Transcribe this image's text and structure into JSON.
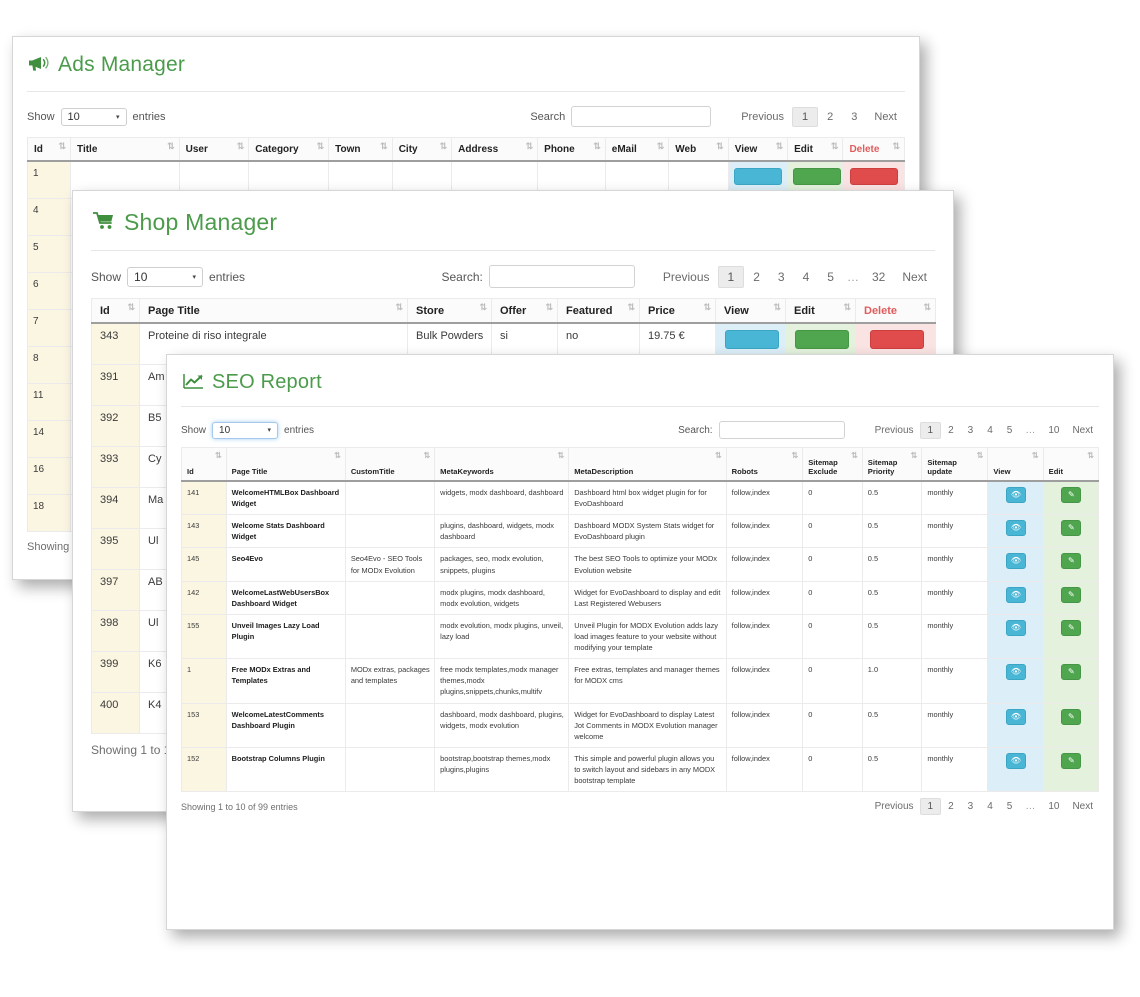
{
  "windows": {
    "ads": {
      "title": "Ads Manager",
      "icon": "megaphone-icon",
      "length": {
        "label_before": "Show",
        "value": "10",
        "label_after": "entries"
      },
      "search": {
        "label": "Search",
        "value": "",
        "placeholder": ""
      },
      "pagination": {
        "previous": "Previous",
        "pages": [
          "1",
          "2",
          "3"
        ],
        "active": "1",
        "next": "Next"
      },
      "columns": [
        "Id",
        "Title",
        "User",
        "Category",
        "Town",
        "City",
        "Address",
        "Phone",
        "eMail",
        "Web",
        "View",
        "Edit",
        "Delete"
      ],
      "rows": [
        {
          "id": "1"
        },
        {
          "id": "4"
        },
        {
          "id": "5"
        },
        {
          "id": "6"
        },
        {
          "id": "7"
        },
        {
          "id": "8"
        },
        {
          "id": "11"
        },
        {
          "id": "14"
        },
        {
          "id": "16"
        },
        {
          "id": "18"
        }
      ],
      "footer_info": "Showing 1 to 10 of 24 entries"
    },
    "shop": {
      "title": "Shop Manager",
      "icon": "shopping-cart-icon",
      "length": {
        "label_before": "Show",
        "value": "10",
        "label_after": "entries"
      },
      "search": {
        "label": "Search:",
        "value": "",
        "placeholder": ""
      },
      "pagination": {
        "previous": "Previous",
        "pages": [
          "1",
          "2",
          "3",
          "4",
          "5",
          "…",
          "32"
        ],
        "active": "1",
        "next": "Next"
      },
      "columns": [
        "Id",
        "Page Title",
        "Store",
        "Offer",
        "Featured",
        "Price",
        "View",
        "Edit",
        "Delete"
      ],
      "rows": [
        {
          "id": "343",
          "page_title": "Proteine di riso integrale",
          "store": "Bulk Powders",
          "offer": "si",
          "featured": "no",
          "price": "19.75 €"
        },
        {
          "id": "391",
          "page_title": "Am",
          "store": "",
          "offer": "",
          "featured": "",
          "price": ""
        },
        {
          "id": "392",
          "page_title": "B5",
          "store": "",
          "offer": "",
          "featured": "",
          "price": ""
        },
        {
          "id": "393",
          "page_title": "Cy",
          "store": "",
          "offer": "",
          "featured": "",
          "price": ""
        },
        {
          "id": "394",
          "page_title": "Ma",
          "store": "",
          "offer": "",
          "featured": "",
          "price": ""
        },
        {
          "id": "395",
          "page_title": "Ul",
          "store": "",
          "offer": "",
          "featured": "",
          "price": ""
        },
        {
          "id": "397",
          "page_title": "AB",
          "store": "",
          "offer": "",
          "featured": "",
          "price": ""
        },
        {
          "id": "398",
          "page_title": "Ul",
          "store": "",
          "offer": "",
          "featured": "",
          "price": ""
        },
        {
          "id": "399",
          "page_title": "K6",
          "store": "",
          "offer": "",
          "featured": "",
          "price": ""
        },
        {
          "id": "400",
          "page_title": "K4",
          "store": "",
          "offer": "",
          "featured": "",
          "price": ""
        }
      ],
      "footer_info": "Showing 1 to 10 of 316 entries"
    },
    "seo": {
      "title": "SEO Report",
      "icon": "chart-line-icon",
      "length": {
        "label_before": "Show",
        "value": "10",
        "label_after": "entries"
      },
      "search": {
        "label": "Search:",
        "value": "",
        "placeholder": ""
      },
      "pagination": {
        "previous": "Previous",
        "pages": [
          "1",
          "2",
          "3",
          "4",
          "5",
          "…",
          "10"
        ],
        "active": "1",
        "next": "Next"
      },
      "columns": [
        "Id",
        "Page Title",
        "CustomTitle",
        "MetaKeywords",
        "MetaDescription",
        "Robots",
        "Sitemap Exclude",
        "Sitemap Priority",
        "Sitemap update",
        "View",
        "Edit"
      ],
      "rows": [
        {
          "id": "141",
          "page_title": "WelcomeHTMLBox Dashboard Widget",
          "custom_title": "",
          "meta_keywords": "widgets, modx dashboard, dashboard",
          "meta_description": "Dashboard html box widget plugin for for EvoDashboard",
          "robots": "follow,index",
          "sitemap_exclude": "0",
          "sitemap_priority": "0.5",
          "sitemap_update": "monthly"
        },
        {
          "id": "143",
          "page_title": "Welcome Stats Dashboard Widget",
          "custom_title": "",
          "meta_keywords": "plugins, dashboard, widgets, modx dashboard",
          "meta_description": "Dashboard MODX System Stats widget for EvoDashboard plugin",
          "robots": "follow,index",
          "sitemap_exclude": "0",
          "sitemap_priority": "0.5",
          "sitemap_update": "monthly"
        },
        {
          "id": "145",
          "page_title": "Seo4Evo",
          "custom_title": "Seo4Evo - SEO Tools for MODx Evolution",
          "meta_keywords": "packages, seo, modx evolution, snippets, plugins",
          "meta_description": "The best SEO Tools to optimize your MODx Evolution website",
          "robots": "follow,index",
          "sitemap_exclude": "0",
          "sitemap_priority": "0.5",
          "sitemap_update": "monthly"
        },
        {
          "id": "142",
          "page_title": "WelcomeLastWebUsersBox Dashboard Widget",
          "custom_title": "",
          "meta_keywords": "modx plugins, modx dashboard, modx evolution, widgets",
          "meta_description": "Widget for EvoDashboard to display and edit Last Registered Webusers",
          "robots": "follow,index",
          "sitemap_exclude": "0",
          "sitemap_priority": "0.5",
          "sitemap_update": "monthly"
        },
        {
          "id": "155",
          "page_title": "Unveil Images Lazy Load Plugin",
          "custom_title": "",
          "meta_keywords": "modx evolution, modx plugins, unveil, lazy load",
          "meta_description": "Unveil Plugin for MODX Evolution adds lazy load images feature to your website without modifying your template",
          "robots": "follow,index",
          "sitemap_exclude": "0",
          "sitemap_priority": "0.5",
          "sitemap_update": "monthly"
        },
        {
          "id": "1",
          "page_title": "Free MODx Extras and Templates",
          "custom_title": "MODx extras, packages and templates",
          "meta_keywords": "free modx templates,modx manager themes,modx plugins,snippets,chunks,multifv",
          "meta_description": "Free extras, templates and manager themes for MODX cms",
          "robots": "follow,index",
          "sitemap_exclude": "0",
          "sitemap_priority": "1.0",
          "sitemap_update": "monthly"
        },
        {
          "id": "153",
          "page_title": "WelcomeLatestComments Dashboard Plugin",
          "custom_title": "",
          "meta_keywords": "dashboard, modx dashboard, plugins, widgets, modx evolution",
          "meta_description": "Widget for EvoDashboard to display Latest Jot Comments in MODX Evolution manager welcome",
          "robots": "follow,index",
          "sitemap_exclude": "0",
          "sitemap_priority": "0.5",
          "sitemap_update": "monthly"
        },
        {
          "id": "152",
          "page_title": "Bootstrap Columns Plugin",
          "custom_title": "",
          "meta_keywords": "bootstrap,bootstrap themes,modx plugins,plugins",
          "meta_description": "This simple and powerful plugin allows you to switch layout and sidebars in any MODX bootstrap template",
          "robots": "follow,index",
          "sitemap_exclude": "0",
          "sitemap_priority": "0.5",
          "sitemap_update": "monthly"
        }
      ],
      "footer_info": "Showing 1 to 10 of 99 entries"
    }
  },
  "icons": {
    "sort": "⇅",
    "caret": "▾",
    "view": "👁",
    "edit": "✎",
    "delete": "✖"
  },
  "colors": {
    "title_green": "#4b9b4b",
    "view_blue": "#49b6d6",
    "edit_green": "#4fa64f",
    "delete_red": "#e04b4b",
    "id_cell": "#fbf6e2",
    "delete_header": "#e05c5c"
  }
}
